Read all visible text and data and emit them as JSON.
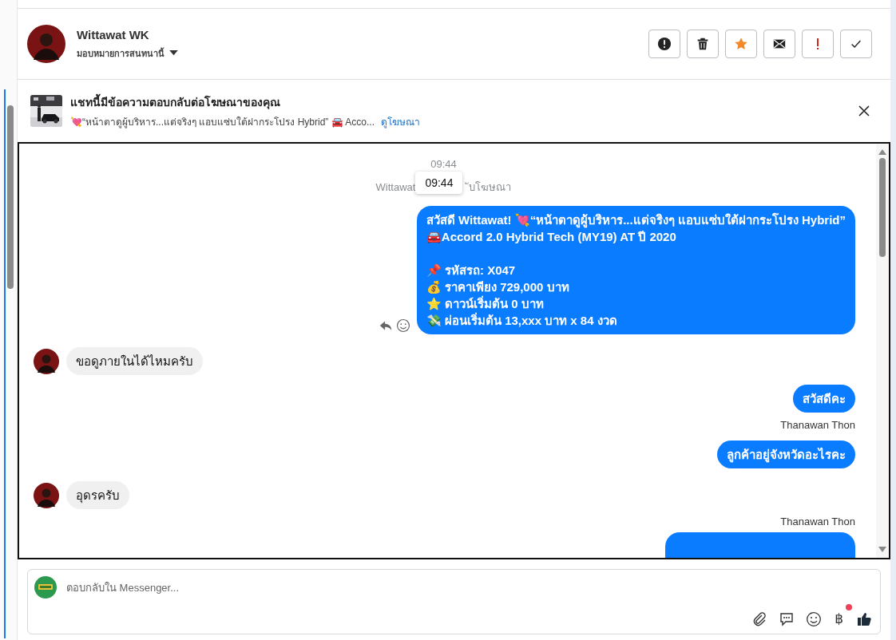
{
  "contact": {
    "name": "Wittawat WK",
    "assign": "มอบหมายการสนทนานี้"
  },
  "actions": [
    {
      "kind": "alert"
    },
    {
      "kind": "trash"
    },
    {
      "kind": "star"
    },
    {
      "kind": "mail"
    },
    {
      "kind": "exclaim"
    },
    {
      "kind": "check"
    }
  ],
  "ad_banner": {
    "title": "แชทนี้มีข้อความตอบกลับต่อโฆษณาของคุณ",
    "snippet": "💘“หน้าตาดูผู้บริหาร...แต่จริงๆ แอบแซ่บใต้ฝากระโปรง Hybrid” 🚘 Acco...",
    "link": "ดูโฆษณา"
  },
  "messages": [
    {
      "kind": "time",
      "text": "09:44"
    },
    {
      "kind": "note",
      "before": "Wittawat",
      "after": "ับโฆษณา",
      "tooltip": "09:44"
    },
    {
      "kind": "out",
      "paragraphs": [
        [
          "สวัสดี Wittawat! 💘“หน้าตาดูผู้บริหาร...แต่จริงๆ แอบแซ่บใต้ฝากระโปรง Hybrid”",
          "🚘Accord 2.0 Hybrid Tech (MY19) AT ปี 2020"
        ],
        [
          "📌 รหัสรถ: X047",
          "💰 ราคาเพียง 729,000 บาท",
          "⭐ ดาวน์เริ่มต้น 0 บาท",
          "💸 ผ่อนเริ่มต้น 13,xxx บาท x 84 งวด"
        ]
      ],
      "hover": true
    },
    {
      "kind": "in",
      "text": "ขอดูภายในได้ไหมครับ"
    },
    {
      "kind": "out",
      "paragraphs": [
        [
          "สวัสดีคะ"
        ]
      ],
      "hover": false
    },
    {
      "kind": "sender",
      "text": "Thanawan Thon"
    },
    {
      "kind": "out",
      "paragraphs": [
        [
          "ลูกค้าอยู่จังหวัดอะไรคะ"
        ]
      ],
      "hover": false
    },
    {
      "kind": "in",
      "text": "อุดรครับ"
    },
    {
      "kind": "sender",
      "text": "Thanawan Thon"
    },
    {
      "kind": "clipped"
    }
  ],
  "composer": {
    "placeholder": "ตอบกลับใน Messenger...",
    "tools": [
      {
        "kind": "attach"
      },
      {
        "kind": "chat"
      },
      {
        "kind": "emoji"
      },
      {
        "kind": "text",
        "text": "฿",
        "badge": true
      },
      {
        "kind": "like"
      }
    ]
  }
}
